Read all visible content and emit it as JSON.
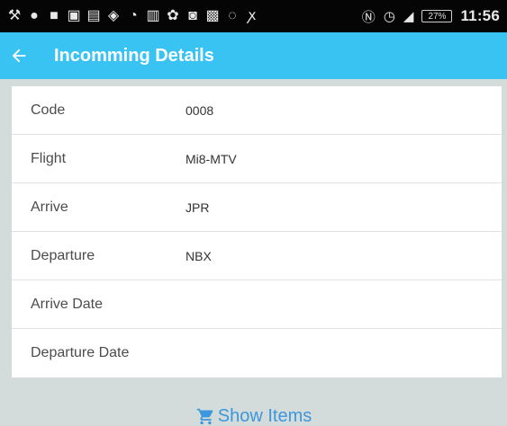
{
  "status_bar": {
    "time": "11:56",
    "battery": "27%"
  },
  "header": {
    "title": "Incomming Details"
  },
  "details": {
    "rows": [
      {
        "label": "Code",
        "value": "0008"
      },
      {
        "label": "Flight",
        "value": "Mi8-MTV"
      },
      {
        "label": "Arrive",
        "value": "JPR"
      },
      {
        "label": "Departure",
        "value": "NBX"
      },
      {
        "label": "Arrive Date",
        "value": ""
      },
      {
        "label": "Departure Date",
        "value": ""
      }
    ]
  },
  "actions": {
    "show_items_label": "Show Items"
  },
  "colors": {
    "app_bar": "#38c3f2",
    "link": "#3c97dc",
    "background": "#d3dcdb"
  },
  "icons": {
    "back": "back-arrow-icon",
    "cart": "cart-icon"
  }
}
